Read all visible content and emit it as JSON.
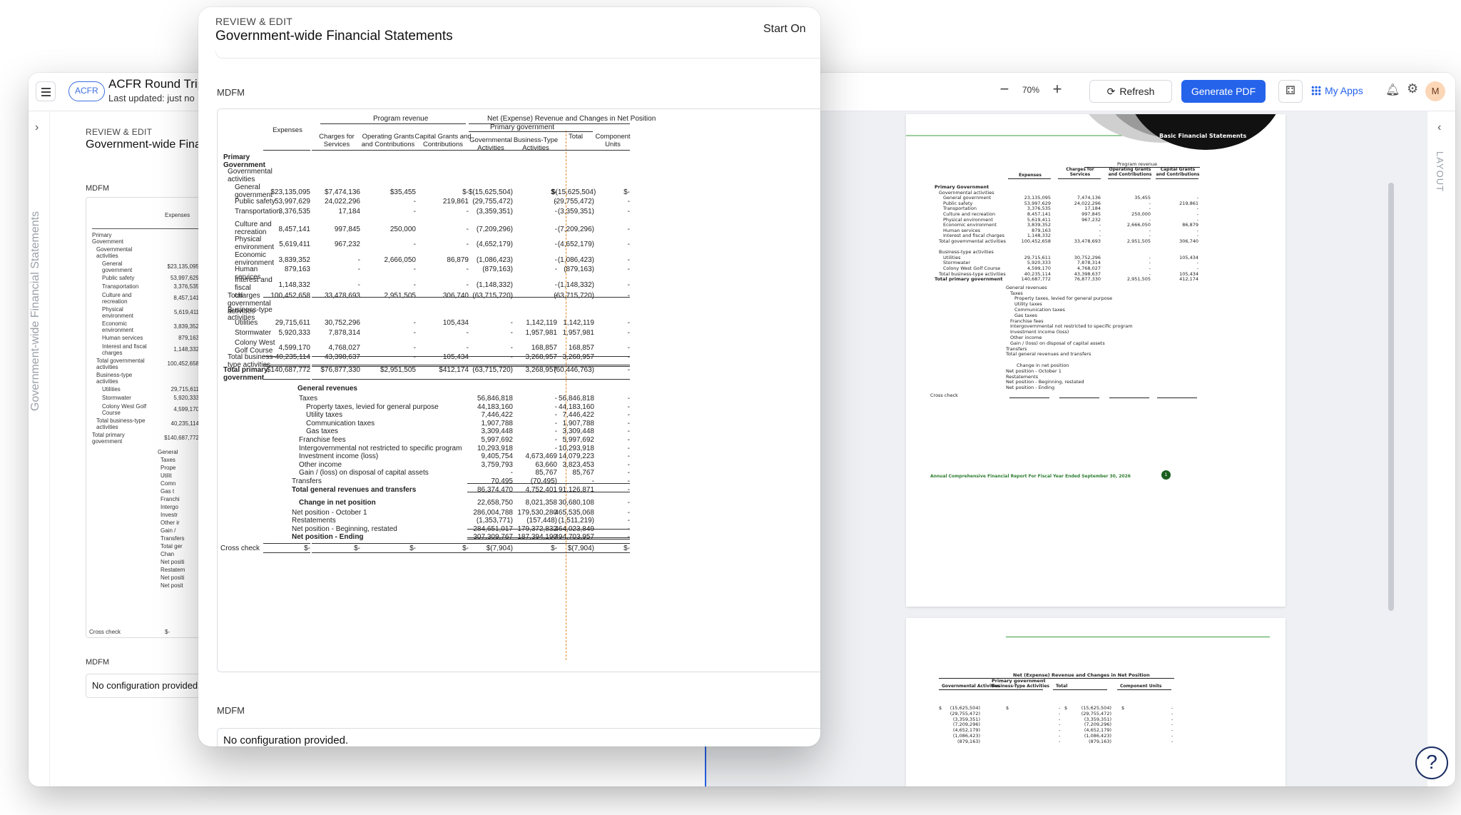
{
  "app": {
    "badge": "ACFR",
    "title": "ACFR Round Trip",
    "subtitle": "Last updated: just no",
    "zoom": "70%",
    "refresh_label": "Refresh",
    "generate_label": "Generate PDF",
    "myapps_label": "My Apps",
    "avatar": "M",
    "left_rail_label": "Government-wide Financial Statements",
    "right_rail_label": "LAYOUT",
    "help_icon": "?"
  },
  "background_panel": {
    "kicker": "REVIEW & EDIT",
    "title": "Government-wide Finan",
    "mdfm": "MDFM",
    "mdfm2": "MDFM",
    "no_config": "No configuration provided.",
    "header_expenses": "Expenses",
    "cross_check": "Cross check",
    "cross_value": "$-",
    "rows": [
      {
        "label": "Primary Government",
        "value": ""
      },
      {
        "label": "Governmental activities",
        "value": ""
      },
      {
        "label": "General government",
        "value": "$23,135,095"
      },
      {
        "label": "Public safety",
        "value": "53,997,629"
      },
      {
        "label": "Transportation",
        "value": "3,376,535"
      },
      {
        "label": "Culture and recreation",
        "value": "8,457,141"
      },
      {
        "label": "Physical environment",
        "value": "5,619,411"
      },
      {
        "label": "Economic environment",
        "value": "3,839,352"
      },
      {
        "label": "Human services",
        "value": "879,163"
      },
      {
        "label": "Interest and fiscal charges",
        "value": "1,148,332"
      },
      {
        "label": "Total governmental activities",
        "value": "100,452,658"
      },
      {
        "label": "Business-type activities",
        "value": ""
      },
      {
        "label": "Utilities",
        "value": "29,715,611"
      },
      {
        "label": "Stormwater",
        "value": "5,920,333"
      },
      {
        "label": "Colony West Golf Course",
        "value": "4,599,170"
      },
      {
        "label": "Total business-type activities",
        "value": "40,235,114"
      },
      {
        "label": "Total primary government",
        "value": "$140,687,772"
      }
    ],
    "partial_labels": [
      "General",
      "Taxes",
      "Prope",
      "Utilit",
      "Comn",
      "Gas t",
      "Franchi",
      "Intergo",
      "Investr",
      "Other ir",
      "Gain /",
      "Transfers",
      "Total ger",
      "Chan",
      "Net positi",
      "Restatem",
      "Net positi",
      "Net posit"
    ]
  },
  "modal": {
    "kicker": "REVIEW & EDIT",
    "title": "Government-wide Financial Statements",
    "start_on": "Start On",
    "mdfm": "MDFM",
    "mdfm2": "MDFM",
    "no_config": "No configuration provided."
  },
  "statement": {
    "group_program_revenue": "Program revenue",
    "group_net": "Net (Expense) Revenue and Changes in Net Position",
    "group_primary_gov": "Primary government",
    "headers": [
      "Expenses",
      "Charges for Services",
      "Operating Grants and Contributions",
      "Capital Grants and Contributions",
      "Governmental Activities",
      "Business-Type Activities",
      "Total",
      "Component Units"
    ],
    "rows": [
      {
        "label": "Primary Government",
        "style": "bold",
        "values": [
          "",
          "",
          "",
          "",
          "",
          "",
          "",
          ""
        ]
      },
      {
        "label": "Governmental activities",
        "style": "ind1",
        "values": [
          "",
          "",
          "",
          "",
          "",
          "",
          "",
          ""
        ]
      },
      {
        "label": "General government",
        "style": "ind2",
        "values": [
          "$23,135,095",
          "$7,474,136",
          "$35,455",
          "$-",
          "$(15,625,504)",
          "$-",
          "$(15,625,504)",
          "$-"
        ]
      },
      {
        "label": "Public safety",
        "style": "ind2",
        "values": [
          "53,997,629",
          "24,022,296",
          "-",
          "219,861",
          "(29,755,472)",
          "-",
          "(29,755,472)",
          "-"
        ]
      },
      {
        "label": "Transportation",
        "style": "ind2",
        "values": [
          "3,376,535",
          "17,184",
          "-",
          "-",
          "(3,359,351)",
          "-",
          "(3,359,351)",
          "-"
        ]
      },
      {
        "label": "Culture and recreation",
        "style": "ind2",
        "values": [
          "8,457,141",
          "997,845",
          "250,000",
          "-",
          "(7,209,296)",
          "-",
          "(7,209,296)",
          "-"
        ]
      },
      {
        "label": "Physical environment",
        "style": "ind2",
        "values": [
          "5,619,411",
          "967,232",
          "-",
          "-",
          "(4,652,179)",
          "-",
          "(4,652,179)",
          "-"
        ]
      },
      {
        "label": "Economic environment",
        "style": "ind2",
        "values": [
          "3,839,352",
          "-",
          "2,666,050",
          "86,879",
          "(1,086,423)",
          "-",
          "(1,086,423)",
          "-"
        ]
      },
      {
        "label": "Human services",
        "style": "ind2",
        "values": [
          "879,163",
          "-",
          "-",
          "-",
          "(879,163)",
          "-",
          "(879,163)",
          "-"
        ]
      },
      {
        "label": "Interest and fiscal charges",
        "style": "ind2",
        "values": [
          "1,148,332",
          "-",
          "-",
          "-",
          "(1,148,332)",
          "-",
          "(1,148,332)",
          "-"
        ]
      },
      {
        "label": "Total governmental activities",
        "style": "ind1",
        "values": [
          "100,452,658",
          "33,478,693",
          "2,951,505",
          "306,740",
          "(63,715,720)",
          "-",
          "(63,715,720)",
          "-"
        ]
      },
      {
        "label": "Business-type activities",
        "style": "ind1",
        "values": [
          "",
          "",
          "",
          "",
          "",
          "",
          "",
          ""
        ]
      },
      {
        "label": "Utilities",
        "style": "ind2",
        "values": [
          "29,715,611",
          "30,752,296",
          "-",
          "105,434",
          "-",
          "1,142,119",
          "1,142,119",
          "-"
        ]
      },
      {
        "label": "Stormwater",
        "style": "ind2",
        "values": [
          "5,920,333",
          "7,878,314",
          "-",
          "-",
          "-",
          "1,957,981",
          "1,957,981",
          "-"
        ]
      },
      {
        "label": "Colony West Golf Course",
        "style": "ind2",
        "values": [
          "4,599,170",
          "4,768,027",
          "-",
          "-",
          "-",
          "168,857",
          "168,857",
          "-"
        ]
      },
      {
        "label": "Total business-type activities",
        "style": "ind1",
        "values": [
          "40,235,114",
          "43,398,637",
          "-",
          "105,434",
          "-",
          "3,268,957",
          "3,268,957",
          "-"
        ]
      },
      {
        "label": "Total primary government",
        "style": "bold",
        "values": [
          "$140,687,772",
          "$76,877,330",
          "$2,951,505",
          "$412,174",
          "(63,715,720)",
          "3,268,957",
          "(60,446,763)",
          "-"
        ]
      }
    ],
    "general_revenues_label": "General revenues",
    "general": [
      {
        "label": "Taxes",
        "indent": 1,
        "values": [
          "56,846,818",
          "-",
          "56,846,818",
          "-"
        ]
      },
      {
        "label": "Property taxes, levied for general purpose",
        "indent": 2,
        "values": [
          "44,183,160",
          "-",
          "44,183,160",
          "-"
        ]
      },
      {
        "label": "Utility taxes",
        "indent": 2,
        "values": [
          "7,446,422",
          "-",
          "7,446,422",
          "-"
        ]
      },
      {
        "label": "Communication taxes",
        "indent": 2,
        "values": [
          "1,907,788",
          "-",
          "1,907,788",
          "-"
        ]
      },
      {
        "label": "Gas taxes",
        "indent": 2,
        "values": [
          "3,309,448",
          "-",
          "3,309,448",
          "-"
        ]
      },
      {
        "label": "Franchise fees",
        "indent": 1,
        "values": [
          "5,997,692",
          "-",
          "5,997,692",
          "-"
        ]
      },
      {
        "label": "Intergovernmental not restricted to specific program",
        "indent": 1,
        "values": [
          "10,293,918",
          "-",
          "10,293,918",
          "-"
        ]
      },
      {
        "label": "Investment income (loss)",
        "indent": 1,
        "values": [
          "9,405,754",
          "4,673,469",
          "14,079,223",
          "-"
        ]
      },
      {
        "label": "Other income",
        "indent": 1,
        "values": [
          "3,759,793",
          "63,660",
          "3,823,453",
          "-"
        ]
      },
      {
        "label": "Gain / (loss) on disposal of capital assets",
        "indent": 1,
        "values": [
          "-",
          "85,767",
          "85,767",
          "-"
        ]
      },
      {
        "label": "Transfers",
        "indent": 0,
        "values": [
          "70,495",
          "(70,495)",
          "-",
          "-"
        ]
      },
      {
        "label": "Total general revenues and transfers",
        "indent": 0,
        "bold": true,
        "values": [
          "86,374,470",
          "4,752,401",
          "91,126,871",
          "-"
        ]
      },
      {
        "label": "Change in net position",
        "indent": 1,
        "bold": true,
        "values": [
          "22,658,750",
          "8,021,358",
          "30,680,108",
          "-"
        ]
      },
      {
        "label": "Net position - October 1",
        "indent": 0,
        "values": [
          "286,004,788",
          "179,530,280",
          "465,535,068",
          "-"
        ]
      },
      {
        "label": "Restatements",
        "indent": 0,
        "values": [
          "(1,353,771)",
          "(157,448)",
          "(1,511,219)",
          "-"
        ]
      },
      {
        "label": "Net position - Beginning, restated",
        "indent": 0,
        "values": [
          "284,651,017",
          "179,372,832",
          "464,023,849",
          "-"
        ]
      },
      {
        "label": "Net position - Ending",
        "indent": 0,
        "bold": true,
        "values": [
          "307,309,767",
          "187,394,190",
          "494,703,957",
          "-"
        ]
      }
    ],
    "cross_check_label": "Cross check",
    "cross_check_values": [
      "$-",
      "$-",
      "$-",
      "$-",
      "$(7,904)",
      "$-",
      "$(7,904)",
      "$-"
    ]
  },
  "preview": {
    "banner": "Basic Financial Statements",
    "footer": "Annual Comprehensive Financial Report  For Fiscal Year Ended September 30, 2026",
    "page_number": "1",
    "p1_group": "Program revenue",
    "p1_headers": [
      "Expenses",
      "Charges for Services",
      "Operating Grants and Contributions",
      "Capital Grants and Contributions"
    ],
    "p1_rows": [
      {
        "label": "Primary Government",
        "v": [
          "",
          "",
          "",
          ""
        ]
      },
      {
        "label": "Governmental activities",
        "v": [
          "",
          "",
          "",
          ""
        ]
      },
      {
        "label": "General government",
        "v": [
          "23,135,095",
          "7,474,136",
          "35,455",
          "-"
        ]
      },
      {
        "label": "Public safety",
        "v": [
          "53,997,629",
          "24,022,296",
          "-",
          "219,861"
        ]
      },
      {
        "label": "Transportation",
        "v": [
          "3,376,535",
          "17,184",
          "-",
          "-"
        ]
      },
      {
        "label": "Culture and recreation",
        "v": [
          "8,457,141",
          "997,845",
          "250,000",
          "-"
        ]
      },
      {
        "label": "Physical environment",
        "v": [
          "5,619,411",
          "967,232",
          "-",
          "-"
        ]
      },
      {
        "label": "Economic environment",
        "v": [
          "3,839,352",
          "-",
          "2,666,050",
          "86,879"
        ]
      },
      {
        "label": "Human services",
        "v": [
          "879,163",
          "-",
          "-",
          "-"
        ]
      },
      {
        "label": "Interest and fiscal charges",
        "v": [
          "1,148,332",
          "-",
          "-",
          "-"
        ]
      },
      {
        "label": "Total governmental activities",
        "v": [
          "100,452,658",
          "33,478,693",
          "2,951,505",
          "306,740"
        ]
      },
      {
        "label": "",
        "v": [
          "",
          "",
          "",
          ""
        ]
      },
      {
        "label": "Business-type activities",
        "v": [
          "",
          "",
          "",
          ""
        ]
      },
      {
        "label": "Utilities",
        "v": [
          "29,715,611",
          "30,752,296",
          "-",
          "105,434"
        ]
      },
      {
        "label": "Stormwater",
        "v": [
          "5,920,333",
          "7,878,314",
          "-",
          "-"
        ]
      },
      {
        "label": "Colony West Golf Course",
        "v": [
          "4,599,170",
          "4,768,027",
          "-",
          "-"
        ]
      },
      {
        "label": "Total business-type activities",
        "v": [
          "40,235,114",
          "43,398,637",
          "-",
          "105,434"
        ]
      },
      {
        "label": "Total primary government",
        "v": [
          "140,687,772",
          "76,877,330",
          "2,951,505",
          "412,174"
        ]
      }
    ],
    "p1_general": [
      "General revenues",
      "Taxes",
      "Property taxes, levied for general purpose",
      "Utility taxes",
      "Communication taxes",
      "Gas taxes",
      "Franchise fees",
      "Intergovernmental not restricted to specific program",
      "Investment income (loss)",
      "Other income",
      "Gain / (loss) on disposal of capital assets",
      "Transfers",
      "Total general revenues and transfers",
      "",
      "Change in net position",
      "Net position - October 1",
      "Restatements",
      "Net position - Beginning, restated",
      "Net position - Ending"
    ],
    "p1_cross_check": "Cross check",
    "p2_group_net": "Net (Expense) Revenue and Changes in Net Position",
    "p2_group_primary": "Primary government",
    "p2_headers": [
      "Governmental Activities",
      "Business-Type Activities",
      "Total",
      "Component Units"
    ],
    "p2_values": [
      "(15,625,504)",
      "(29,755,472)",
      "(3,359,351)",
      "(7,209,296)",
      "(4,652,179)",
      "(1,086,423)",
      "(879,163)"
    ]
  }
}
